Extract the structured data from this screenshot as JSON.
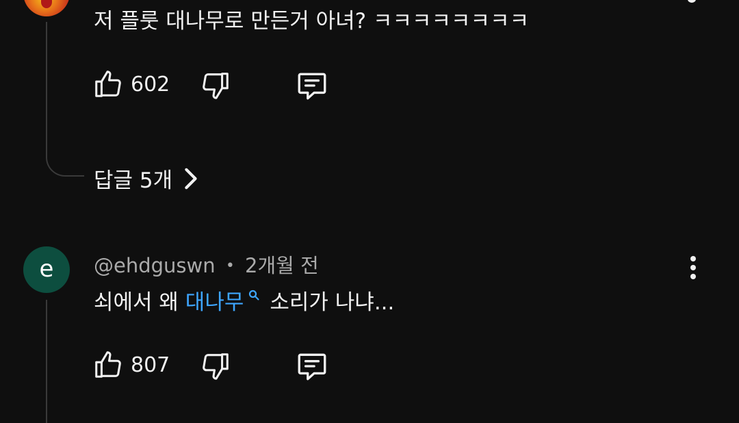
{
  "comment_1": {
    "text": "저 플룻 대나무로 만든거 아녀? ㅋㅋㅋㅋㅋㅋㅋㅋ",
    "like_count": "602",
    "replies_label": "답글 5개"
  },
  "comment_2": {
    "avatar_letter": "e",
    "avatar_color": "#0d4e3f",
    "author": "@ehdguswn",
    "separator": "•",
    "time": "2개월 전",
    "text_before": "쇠에서 왜",
    "link_text": "대나무",
    "text_after": "소리가 나냐...",
    "like_count": "807"
  },
  "colors": {
    "background": "#0f0f0f",
    "text": "#f1f1f1",
    "secondary_text": "#aaaaaa",
    "link": "#3ea6ff",
    "thread_line": "#3a3a3a"
  },
  "icons": {
    "like": "thumbs-up-icon",
    "dislike": "thumbs-down-icon",
    "reply": "comment-icon",
    "more": "more-vertical-icon",
    "chevron": "chevron-right-icon",
    "search": "search-icon"
  }
}
